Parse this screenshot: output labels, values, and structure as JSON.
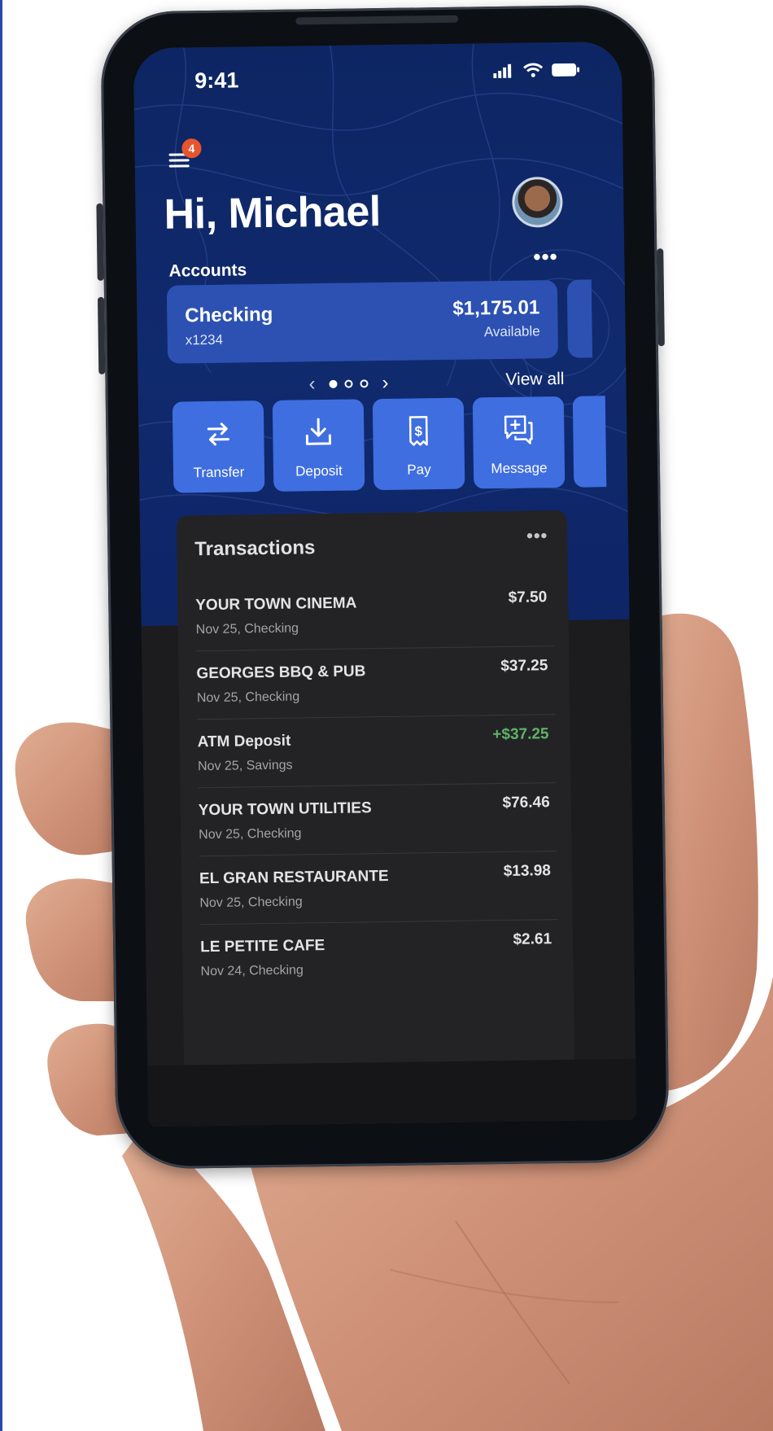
{
  "status_bar": {
    "time": "9:41"
  },
  "header": {
    "notification_count": "4",
    "greeting": "Hi, Michael",
    "accounts_label": "Accounts",
    "more": "•••"
  },
  "accounts": [
    {
      "name": "Checking",
      "number": "x1234",
      "balance": "$1,175.01",
      "balance_label": "Available"
    }
  ],
  "carousel": {
    "prev": "‹",
    "next": "›",
    "view_all": "View all"
  },
  "actions": [
    {
      "label": "Transfer",
      "icon": "transfer-icon"
    },
    {
      "label": "Deposit",
      "icon": "deposit-icon"
    },
    {
      "label": "Pay",
      "icon": "pay-icon"
    },
    {
      "label": "Message",
      "icon": "message-icon"
    }
  ],
  "transactions": {
    "title": "Transactions",
    "more": "•••",
    "items": [
      {
        "merchant": "YOUR TOWN CINEMA",
        "detail": "Nov 25, Checking",
        "amount": "$7.50"
      },
      {
        "merchant": "GEORGES BBQ & PUB",
        "detail": "Nov 25, Checking",
        "amount": "$37.25"
      },
      {
        "merchant": "ATM Deposit",
        "detail": "Nov 25, Savings",
        "amount": "+$37.25"
      },
      {
        "merchant": "YOUR TOWN UTILITIES",
        "detail": "Nov 25, Checking",
        "amount": "$76.46"
      },
      {
        "merchant": "EL GRAN RESTAURANTE",
        "detail": "Nov 25, Checking",
        "amount": "$13.98"
      },
      {
        "merchant": "LE PETITE CAFE",
        "detail": "Nov 24, Checking",
        "amount": "$2.61"
      }
    ]
  },
  "colors": {
    "hero_bg": "#0d2563",
    "card": "#2c51b3",
    "action": "#3f6ee0",
    "badge": "#e8552d",
    "credit": "#5fb36a",
    "panel": "#232325"
  }
}
